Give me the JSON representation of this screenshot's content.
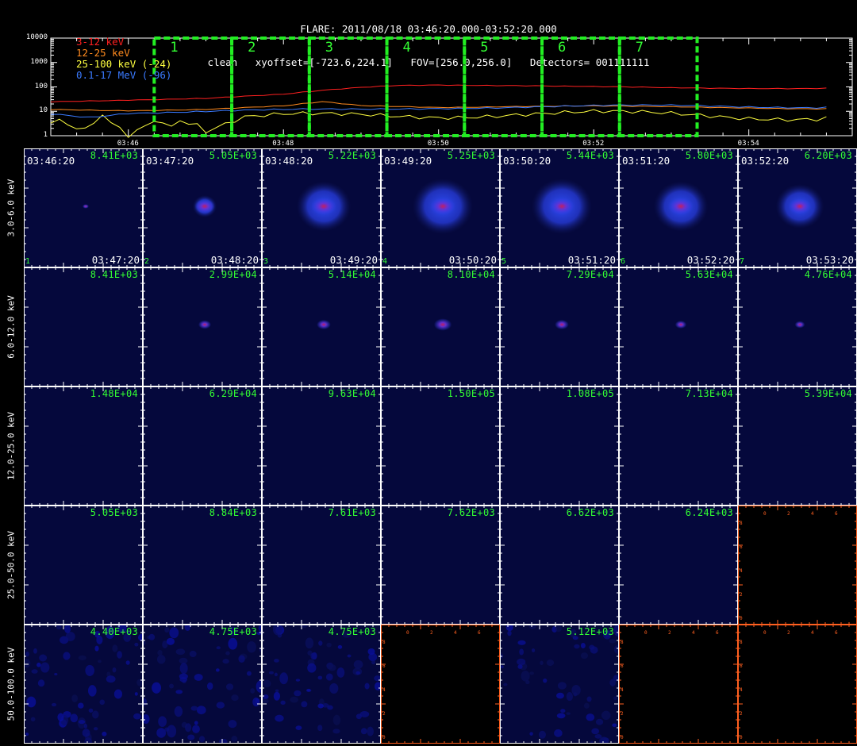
{
  "header": {
    "line1": "FLARE: 2011/08/18 03:46:20.000-03:52:20.000",
    "line2": "clean   xyoffset=[-723.6,224.1]   FOV=[256.0,256.0]   Detectors= 001111111"
  },
  "chart_data": [
    {
      "type": "line",
      "yscale": "log",
      "ylim": [
        1,
        10000
      ],
      "yticks": [
        "10000",
        "1000",
        "100",
        "10",
        "1"
      ],
      "xticks": [
        "03:46",
        "03:48",
        "03:50",
        "03:52",
        "03:54"
      ],
      "legend": [
        {
          "label": "3-12 keV",
          "color": "#ff2020"
        },
        {
          "label": "12-25 keV",
          "color": "#ff8a1e"
        },
        {
          "label": "25-100 keV (-24)",
          "color": "#ffff40"
        },
        {
          "label": "0.1-17 MeV (-96)",
          "color": "#3a7aff"
        }
      ],
      "series": [
        {
          "name": "3-12 keV",
          "color": "#ff2020",
          "x": [
            "03:45:00",
            "03:46:00",
            "03:47:00",
            "03:48:00",
            "03:48:30",
            "03:49:00",
            "03:49:30",
            "03:50:00",
            "03:51:00",
            "03:52:00",
            "03:53:00",
            "03:54:00",
            "03:55:00"
          ],
          "values": [
            25,
            30,
            34,
            48,
            70,
            95,
            118,
            125,
            115,
            100,
            90,
            88,
            90
          ]
        },
        {
          "name": "12-25 keV",
          "color": "#ff8a1e",
          "x": [
            "03:45:00",
            "03:46:00",
            "03:47:00",
            "03:48:00",
            "03:48:30",
            "03:49:00",
            "03:50:00",
            "03:51:00",
            "03:52:00",
            "03:53:00",
            "03:54:00",
            "03:55:00"
          ],
          "values": [
            12,
            11,
            12,
            16,
            24,
            17,
            15,
            16,
            16,
            15,
            14,
            13
          ]
        },
        {
          "name": "25-100 keV (-24)",
          "color": "#ffff40",
          "x": [
            "03:45:00",
            "03:45:20",
            "03:45:40",
            "03:46:00",
            "03:46:20",
            "03:46:40",
            "03:47:00",
            "03:47:30",
            "03:48:00",
            "03:49:00",
            "03:50:00",
            "03:51:00",
            "03:52:00",
            "03:53:00",
            "03:54:00",
            "03:55:00"
          ],
          "values": [
            4,
            2,
            5,
            1.3,
            3,
            4,
            1.5,
            5,
            6,
            7,
            7,
            8,
            8,
            7,
            6,
            6
          ]
        },
        {
          "name": "0.1-17 MeV (-96)",
          "color": "#3a7aff",
          "x": [
            "03:45:00",
            "03:45:30",
            "03:46:00",
            "03:47:00",
            "03:48:00",
            "03:49:00",
            "03:50:00",
            "03:51:00",
            "03:52:00",
            "03:53:00",
            "03:54:00",
            "03:55:00"
          ],
          "values": [
            8,
            6,
            9,
            10,
            11,
            12,
            14,
            15,
            16,
            17,
            16,
            15
          ]
        }
      ],
      "intervals": [
        "1",
        "2",
        "3",
        "4",
        "5",
        "6",
        "7"
      ]
    },
    {
      "type": "heatmap",
      "rows": [
        {
          "label": "3.0-6.0 keV",
          "cells": [
            {
              "max": "8.41E+03",
              "start": "03:46:20",
              "end": "03:47:20",
              "index": "1",
              "status": "image",
              "blob": 0.25,
              "halo": 0
            },
            {
              "max": "5.05E+03",
              "start": "03:47:20",
              "end": "03:48:20",
              "index": "2",
              "status": "image",
              "blob": 0.8,
              "halo": 0.4
            },
            {
              "max": "5.22E+03",
              "start": "03:48:20",
              "end": "03:49:20",
              "index": "3",
              "status": "image",
              "blob": 1,
              "halo": 0.9
            },
            {
              "max": "5.25E+03",
              "start": "03:49:20",
              "end": "03:50:20",
              "index": "4",
              "status": "image",
              "blob": 1,
              "halo": 1
            },
            {
              "max": "5.44E+03",
              "start": "03:50:20",
              "end": "03:51:20",
              "index": "5",
              "status": "image",
              "blob": 1,
              "halo": 1
            },
            {
              "max": "5.80E+03",
              "start": "03:51:20",
              "end": "03:52:20",
              "index": "6",
              "status": "image",
              "blob": 1,
              "halo": 0.9
            },
            {
              "max": "6.20E+03",
              "start": "03:52:20",
              "end": "03:53:20",
              "index": "7",
              "status": "image",
              "blob": 0.9,
              "halo": 0.8
            }
          ]
        },
        {
          "label": "6.0-12.0 keV",
          "cells": [
            {
              "max": "8.41E+03",
              "status": "image",
              "blob": 0,
              "halo": 0
            },
            {
              "max": "2.99E+04",
              "status": "image",
              "blob": 0.5,
              "halo": 0
            },
            {
              "max": "5.14E+04",
              "status": "image",
              "blob": 0.55,
              "halo": 0
            },
            {
              "max": "8.10E+04",
              "status": "image",
              "blob": 0.7,
              "halo": 0
            },
            {
              "max": "7.29E+04",
              "status": "image",
              "blob": 0.55,
              "halo": 0
            },
            {
              "max": "5.63E+04",
              "status": "image",
              "blob": 0.45,
              "halo": 0
            },
            {
              "max": "4.76E+04",
              "status": "image",
              "blob": 0.4,
              "halo": 0
            }
          ]
        },
        {
          "label": "12.0-25.0 keV",
          "cells": [
            {
              "max": "1.48E+04",
              "status": "image",
              "blob": 0,
              "halo": 0
            },
            {
              "max": "6.29E+04",
              "status": "image",
              "blob": 0,
              "halo": 0
            },
            {
              "max": "9.63E+04",
              "status": "image",
              "blob": 0,
              "halo": 0
            },
            {
              "max": "1.50E+05",
              "status": "image",
              "blob": 0,
              "halo": 0
            },
            {
              "max": "1.08E+05",
              "status": "image",
              "blob": 0,
              "halo": 0
            },
            {
              "max": "7.13E+04",
              "status": "image",
              "blob": 0,
              "halo": 0
            },
            {
              "max": "5.39E+04",
              "status": "image",
              "blob": 0,
              "halo": 0
            }
          ]
        },
        {
          "label": "25.0-50.0 keV",
          "cells": [
            {
              "max": "5.05E+03",
              "status": "image",
              "blob": 0,
              "halo": 0
            },
            {
              "max": "8.84E+03",
              "status": "image",
              "blob": 0,
              "halo": 0
            },
            {
              "max": "7.61E+03",
              "status": "image",
              "blob": 0,
              "halo": 0
            },
            {
              "max": "7.62E+03",
              "status": "image",
              "blob": 0,
              "halo": 0
            },
            {
              "max": "6.62E+03",
              "status": "image",
              "blob": 0,
              "halo": 0
            },
            {
              "max": "6.24E+03",
              "status": "image",
              "blob": 0,
              "halo": 0
            },
            {
              "max": "",
              "status": "empty"
            }
          ]
        },
        {
          "label": "50.0-100.0 keV",
          "cells": [
            {
              "max": "4.40E+03",
              "status": "noise",
              "blob": 0,
              "halo": 0
            },
            {
              "max": "4.75E+03",
              "status": "noise",
              "blob": 0,
              "halo": 0
            },
            {
              "max": "4.75E+03",
              "status": "noise",
              "blob": 0,
              "halo": 0
            },
            {
              "max": "",
              "status": "empty"
            },
            {
              "max": "5.12E+03",
              "status": "noise",
              "blob": 0,
              "halo": 0
            },
            {
              "max": "",
              "status": "empty"
            },
            {
              "max": "",
              "status": "empty"
            }
          ]
        }
      ],
      "empty_axis_ticks": [
        "0",
        "2",
        "4",
        "6",
        "8"
      ]
    }
  ],
  "colors": {
    "background": "#000000",
    "image_bg": "#05083c",
    "grid_tick": "#ffffff",
    "interval_box": "#22ee22",
    "label_green": "#33ff33",
    "empty_frame": "#ff6020"
  }
}
